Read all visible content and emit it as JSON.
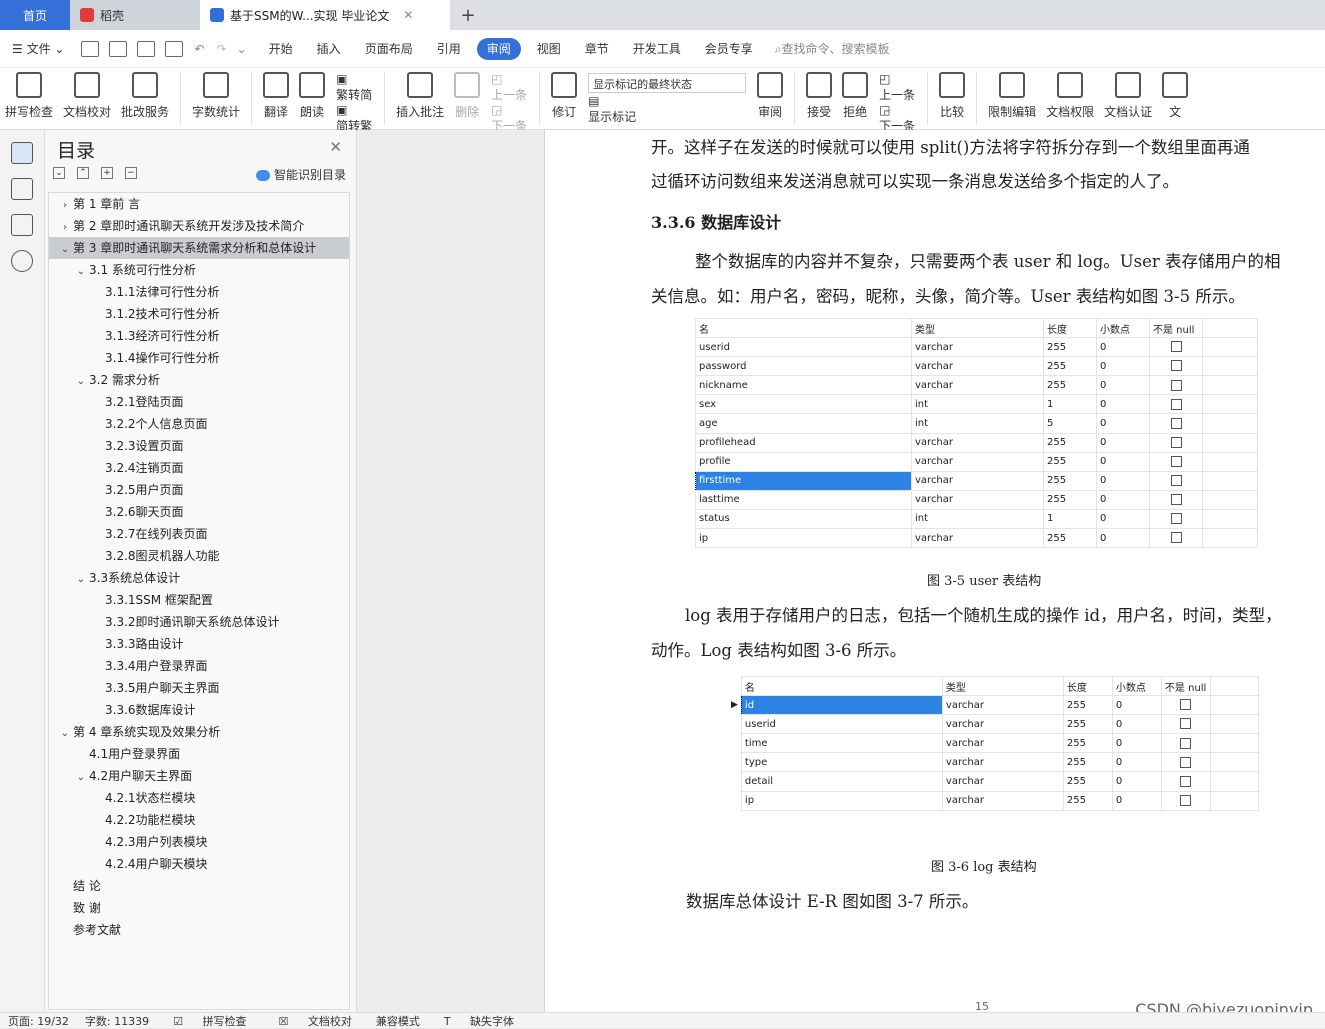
{
  "tabs": {
    "home": "首页",
    "doc1": "稻壳",
    "doc2": "基于SSM的W...实现 毕业论文",
    "new_tab": "+"
  },
  "menu": {
    "file": "文件",
    "items": [
      "开始",
      "插入",
      "页面布局",
      "引用",
      "审阅",
      "视图",
      "章节",
      "开发工具",
      "会员专享"
    ],
    "active": "审阅",
    "search": "查找命令、搜索模板"
  },
  "ribbon": {
    "spell": "拼写检查",
    "proof": "文档校对",
    "batch": "批改服务",
    "wordcount": "字数统计",
    "translate": "翻译",
    "read": "朗读",
    "to_trad": "繁转简",
    "to_simp": "简转繁",
    "insert_comment": "插入批注",
    "delete": "删除",
    "prev": "上一条",
    "next": "下一条",
    "track": "修订",
    "markup_select": "显示标记的最终状态",
    "show_markup": "显示标记",
    "review": "审阅",
    "accept": "接受",
    "reject": "拒绝",
    "prev2": "上一条",
    "next2": "下一条",
    "compare": "比较",
    "restrict": "限制编辑",
    "perm": "文档权限",
    "cert": "文档认证",
    "more": "文"
  },
  "nav": {
    "title": "目录",
    "ai": "智能识别目录",
    "items": [
      {
        "text": "第 1 章前  言",
        "level": 0,
        "arrow": "›"
      },
      {
        "text": "第 2 章即时通讯聊天系统开发涉及技术简介",
        "level": 0,
        "arrow": "›"
      },
      {
        "text": "第 3 章即时通讯聊天系统需求分析和总体设计",
        "level": 0,
        "arrow": "⌄"
      },
      {
        "text": "3.1  系统可行性分析",
        "level": 1,
        "arrow": "⌄"
      },
      {
        "text": "3.1.1法律可行性分析",
        "level": 2,
        "arrow": ""
      },
      {
        "text": "3.1.2技术可行性分析",
        "level": 2,
        "arrow": ""
      },
      {
        "text": "3.1.3经济可行性分析",
        "level": 2,
        "arrow": ""
      },
      {
        "text": "3.1.4操作可行性分析",
        "level": 2,
        "arrow": ""
      },
      {
        "text": "3.2  需求分析",
        "level": 1,
        "arrow": "⌄"
      },
      {
        "text": "3.2.1登陆页面",
        "level": 2,
        "arrow": ""
      },
      {
        "text": "3.2.2个人信息页面",
        "level": 2,
        "arrow": ""
      },
      {
        "text": "3.2.3设置页面",
        "level": 2,
        "arrow": ""
      },
      {
        "text": "3.2.4注销页面",
        "level": 2,
        "arrow": ""
      },
      {
        "text": "3.2.5用户页面",
        "level": 2,
        "arrow": ""
      },
      {
        "text": "3.2.6聊天页面",
        "level": 2,
        "arrow": ""
      },
      {
        "text": "3.2.7在线列表页面",
        "level": 2,
        "arrow": ""
      },
      {
        "text": "3.2.8图灵机器人功能",
        "level": 2,
        "arrow": ""
      },
      {
        "text": "3.3系统总体设计",
        "level": 1,
        "arrow": "⌄"
      },
      {
        "text": "3.3.1SSM 框架配置",
        "level": 2,
        "arrow": ""
      },
      {
        "text": "3.3.2即时通讯聊天系统总体设计",
        "level": 2,
        "arrow": ""
      },
      {
        "text": "3.3.3路由设计",
        "level": 2,
        "arrow": ""
      },
      {
        "text": "3.3.4用户登录界面",
        "level": 2,
        "arrow": ""
      },
      {
        "text": "3.3.5用户聊天主界面",
        "level": 2,
        "arrow": ""
      },
      {
        "text": "3.3.6数据库设计",
        "level": 2,
        "arrow": ""
      },
      {
        "text": "第 4 章系统实现及效果分析",
        "level": 0,
        "arrow": "⌄"
      },
      {
        "text": "4.1用户登录界面",
        "level": 1,
        "arrow": ""
      },
      {
        "text": "4.2用户聊天主界面",
        "level": 1,
        "arrow": "⌄"
      },
      {
        "text": "4.2.1状态栏模块",
        "level": 2,
        "arrow": ""
      },
      {
        "text": "4.2.2功能栏模块",
        "level": 2,
        "arrow": ""
      },
      {
        "text": "4.2.3用户列表模块",
        "level": 2,
        "arrow": ""
      },
      {
        "text": "4.2.4用户聊天模块",
        "level": 2,
        "arrow": ""
      },
      {
        "text": "结  论",
        "level": 0,
        "arrow": ""
      },
      {
        "text": "致  谢",
        "level": 0,
        "arrow": ""
      },
      {
        "text": "参考文献",
        "level": 0,
        "arrow": ""
      }
    ],
    "active_index": 2
  },
  "doc": {
    "p1": "开。这样子在发送的时候就可以使用 split()方法将字符拆分存到一个数组里面再通",
    "p2": "过循环访问数组来发送消息就可以实现一条消息发送给多个指定的人了。",
    "heading": "3.3.6 数据库设计",
    "p3": "整个数据库的内容并不复杂，只需要两个表 user 和 log。User 表存储用户的相",
    "p4": "关信息。如：用户名，密码，昵称，头像，简介等。User 表结构如图 3-5 所示。",
    "caption1": "图 3-5 user 表结构",
    "p5": "log 表用于存储用户的日志，包括一个随机生成的操作 id，用户名，时间，类型，",
    "p6": "动作。Log 表结构如图 3-6 所示。",
    "caption2": "图 3-6 log 表结构",
    "p7": "数据库总体设计 E-R 图如图 3-7 所示。",
    "page_number": "15"
  },
  "table_headers": [
    "名",
    "类型",
    "长度",
    "小数点",
    "不是 null"
  ],
  "user_rows": [
    [
      "userid",
      "varchar",
      "255",
      "0"
    ],
    [
      "password",
      "varchar",
      "255",
      "0"
    ],
    [
      "nickname",
      "varchar",
      "255",
      "0"
    ],
    [
      "sex",
      "int",
      "1",
      "0"
    ],
    [
      "age",
      "int",
      "5",
      "0"
    ],
    [
      "profilehead",
      "varchar",
      "255",
      "0"
    ],
    [
      "profile",
      "varchar",
      "255",
      "0"
    ],
    [
      "firsttime",
      "varchar",
      "255",
      "0"
    ],
    [
      "lasttime",
      "varchar",
      "255",
      "0"
    ],
    [
      "status",
      "int",
      "1",
      "0"
    ],
    [
      "ip",
      "varchar",
      "255",
      "0"
    ]
  ],
  "user_selected_row": 7,
  "log_rows": [
    [
      "id",
      "varchar",
      "255",
      "0"
    ],
    [
      "userid",
      "varchar",
      "255",
      "0"
    ],
    [
      "time",
      "varchar",
      "255",
      "0"
    ],
    [
      "type",
      "varchar",
      "255",
      "0"
    ],
    [
      "detail",
      "varchar",
      "255",
      "0"
    ],
    [
      "ip",
      "varchar",
      "255",
      "0"
    ]
  ],
  "log_selected_row": 0,
  "status": {
    "page": "页面: 19/32",
    "words": "字数: 11339",
    "spell": "拼写检查",
    "proof": "文档校对",
    "compat": "兼容模式",
    "font": "缺失字体"
  },
  "watermark": "CSDN @biyezuopinvip"
}
